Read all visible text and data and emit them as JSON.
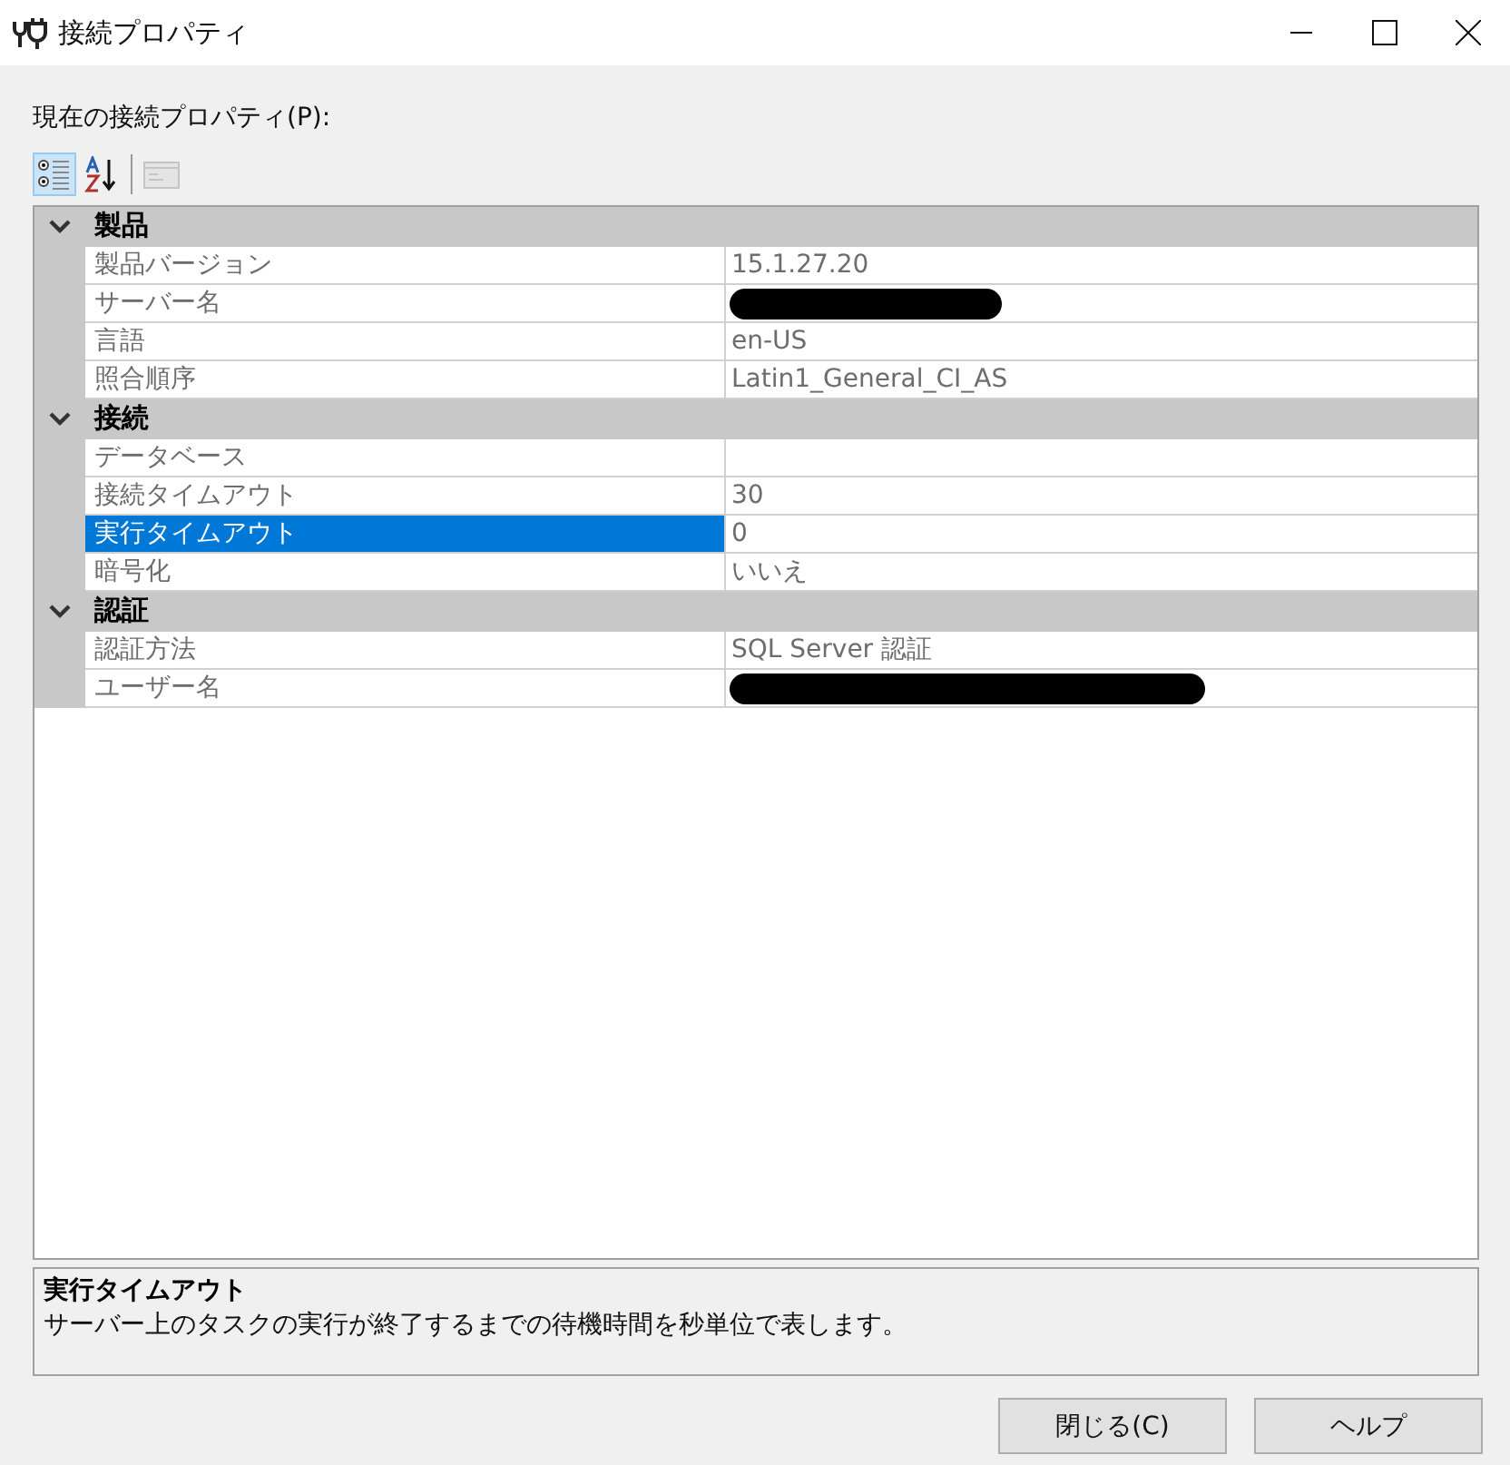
{
  "window": {
    "title": "接続プロパティ"
  },
  "label": "現在の接続プロパティ(P):",
  "toolbar": [
    {
      "kind": "categorized",
      "selected": true,
      "disabled": false
    },
    {
      "kind": "alphabetical",
      "selected": false,
      "disabled": false
    },
    {
      "kind": "pages",
      "selected": false,
      "disabled": true
    }
  ],
  "categories": [
    {
      "name": "製品",
      "expanded": true,
      "items": [
        {
          "name": "製品バージョン",
          "value": "15.1.27.20",
          "selected": false
        },
        {
          "name": "サーバー名",
          "selected": false,
          "redacted": true
        },
        {
          "name": "言語",
          "value": "en-US",
          "selected": false
        },
        {
          "name": "照合順序",
          "value": "Latin1_General_CI_AS",
          "selected": false
        }
      ]
    },
    {
      "name": "接続",
      "expanded": true,
      "items": [
        {
          "name": "データベース",
          "selected": false
        },
        {
          "name": "接続タイムアウト",
          "value": "30",
          "selected": false
        },
        {
          "name": "実行タイムアウト",
          "value": "0",
          "selected": true
        },
        {
          "name": "暗号化",
          "value": "いいえ",
          "selected": false
        }
      ]
    },
    {
      "name": "認証",
      "expanded": true,
      "items": [
        {
          "name": "認証方法",
          "value": "SQL Server 認証",
          "selected": false
        },
        {
          "name": "ユーザー名",
          "selected": false,
          "redacted": true
        }
      ]
    }
  ],
  "description": {
    "title": "実行タイムアウト",
    "text": "サーバー上のタスクの実行が終了するまでの待機時間を秒単位で表します。"
  },
  "buttons": [
    "閉じる(C)",
    "ヘルプ"
  ]
}
